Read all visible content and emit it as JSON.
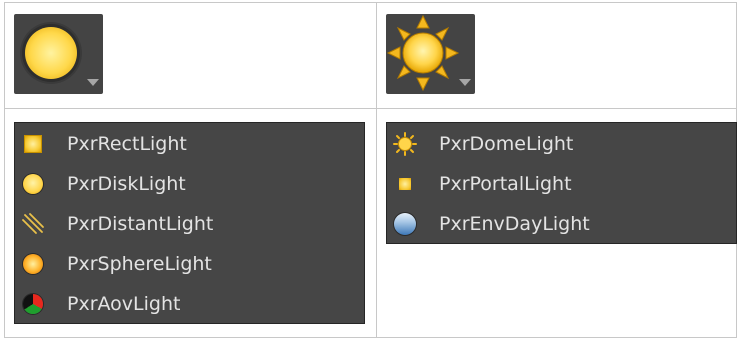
{
  "top_left_button": {
    "icon": "disk-light-icon",
    "has_dropdown": true
  },
  "top_right_button": {
    "icon": "dome-light-icon",
    "has_dropdown": true
  },
  "left_menu": {
    "items": [
      {
        "label": "PxrRectLight",
        "icon": "rect-light-icon"
      },
      {
        "label": "PxrDiskLight",
        "icon": "disk-light-icon"
      },
      {
        "label": "PxrDistantLight",
        "icon": "distant-light-icon"
      },
      {
        "label": "PxrSphereLight",
        "icon": "sphere-light-icon"
      },
      {
        "label": "PxrAovLight",
        "icon": "aov-light-icon"
      }
    ]
  },
  "right_menu": {
    "items": [
      {
        "label": "PxrDomeLight",
        "icon": "dome-light-icon"
      },
      {
        "label": "PxrPortalLight",
        "icon": "portal-light-icon"
      },
      {
        "label": "PxrEnvDayLight",
        "icon": "env-day-light-icon"
      }
    ]
  },
  "colors": {
    "menu_bg": "#464646",
    "menu_text": "#e3e3e3",
    "light_yellow": "#ffd54a",
    "grid_line": "#c8c8c8"
  }
}
